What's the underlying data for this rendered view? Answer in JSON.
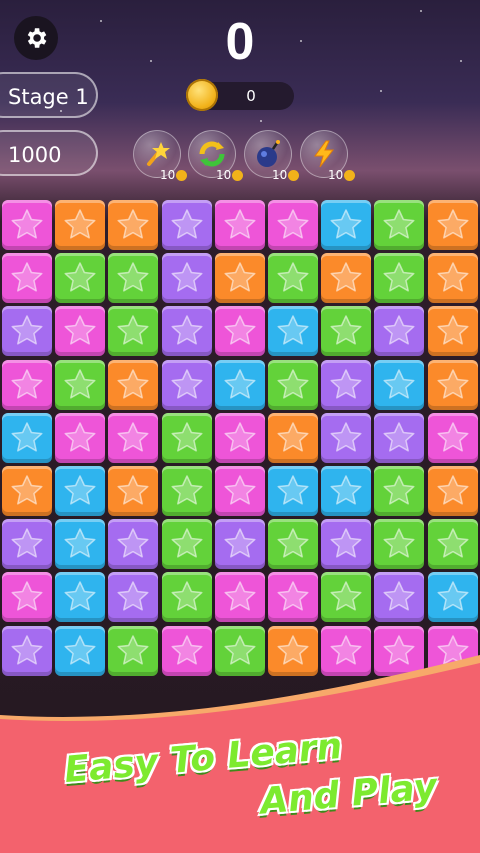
{
  "hud": {
    "score": "0",
    "coins": "0",
    "stage_label": "Stage 1",
    "target_score": "1000"
  },
  "powerups": [
    {
      "name": "magic-wand",
      "price": "10"
    },
    {
      "name": "color-swap",
      "price": "10"
    },
    {
      "name": "bomb",
      "price": "10"
    },
    {
      "name": "lightning",
      "price": "10"
    }
  ],
  "colors": {
    "pink": "#ee55d8",
    "orange": "#fb8a2a",
    "purple": "#a56cf0",
    "blue": "#2fb4ee",
    "green": "#63d23a"
  },
  "board": {
    "rows": [
      [
        "pink",
        "orange",
        "orange",
        "purple",
        "pink",
        "pink",
        "blue",
        "green",
        "orange"
      ],
      [
        "pink",
        "green",
        "green",
        "purple",
        "orange",
        "green",
        "orange",
        "green",
        "orange"
      ],
      [
        "purple",
        "pink",
        "green",
        "purple",
        "pink",
        "blue",
        "green",
        "purple",
        "orange"
      ],
      [
        "pink",
        "green",
        "orange",
        "purple",
        "blue",
        "green",
        "purple",
        "blue",
        "orange"
      ],
      [
        "blue",
        "pink",
        "pink",
        "green",
        "pink",
        "orange",
        "purple",
        "purple",
        "pink"
      ],
      [
        "orange",
        "blue",
        "orange",
        "green",
        "pink",
        "blue",
        "blue",
        "green",
        "orange"
      ],
      [
        "purple",
        "blue",
        "purple",
        "green",
        "purple",
        "green",
        "purple",
        "green",
        "green"
      ],
      [
        "pink",
        "blue",
        "purple",
        "green",
        "pink",
        "pink",
        "green",
        "purple",
        "blue"
      ],
      [
        "purple",
        "blue",
        "green",
        "pink",
        "green",
        "orange",
        "pink",
        "pink",
        "pink"
      ]
    ]
  },
  "promo": {
    "line1": "Easy To Learn",
    "line2": "And Play"
  }
}
